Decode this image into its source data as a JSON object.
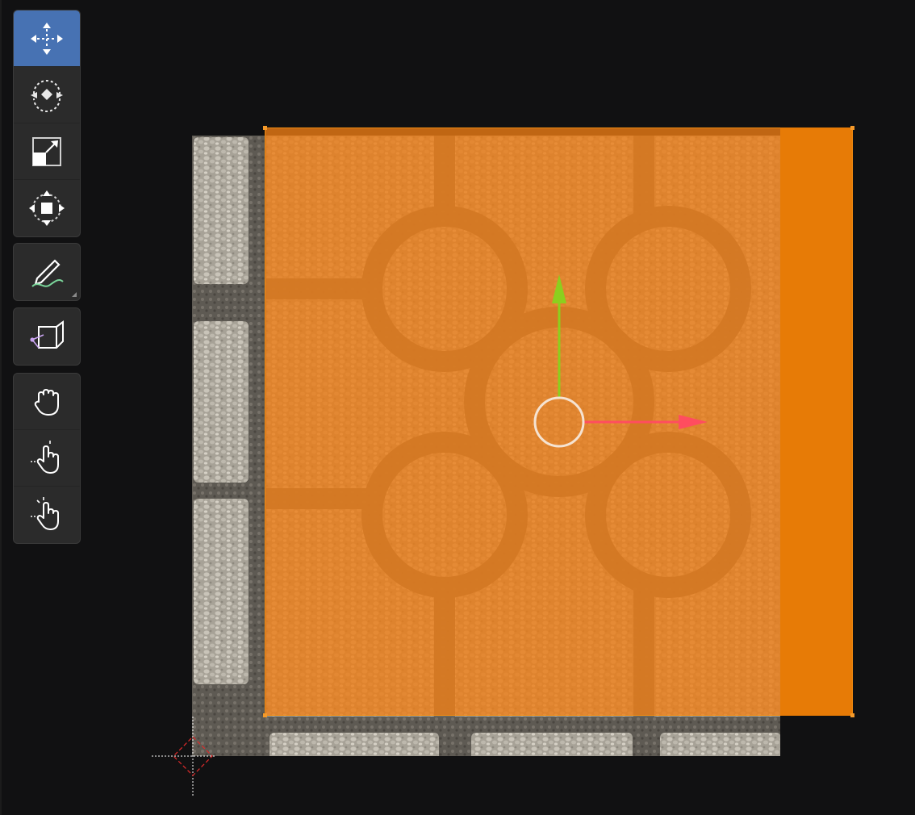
{
  "app": {
    "editor": "UV Editor"
  },
  "toolbar": {
    "groups": [
      {
        "tools": [
          {
            "name": "move-tool",
            "icon": "move-icon",
            "active": true
          },
          {
            "name": "rotate-tool",
            "icon": "rotate-icon",
            "active": false
          },
          {
            "name": "scale-tool",
            "icon": "scale-icon",
            "active": false
          },
          {
            "name": "transform-tool",
            "icon": "transform-icon",
            "active": false
          }
        ]
      },
      {
        "tools": [
          {
            "name": "annotate-tool",
            "icon": "annotate-icon",
            "active": false
          }
        ]
      },
      {
        "tools": [
          {
            "name": "rip-region-tool",
            "icon": "rip-region-icon",
            "active": false
          }
        ]
      },
      {
        "tools": [
          {
            "name": "grab-tool",
            "icon": "grab-hand-icon",
            "active": false
          },
          {
            "name": "relax-tool",
            "icon": "relax-hand-icon",
            "active": false
          },
          {
            "name": "pinch-tool",
            "icon": "pinch-hand-icon",
            "active": false
          }
        ]
      }
    ]
  },
  "colors": {
    "background": "#111112",
    "active_tool": "#4772b3",
    "selection": "#e77b06",
    "gizmo_x": "#ff4d5f",
    "gizmo_y": "#8ccf1e",
    "gizmo_center": "#f5e3d2",
    "cursor": "#e02b2b"
  }
}
